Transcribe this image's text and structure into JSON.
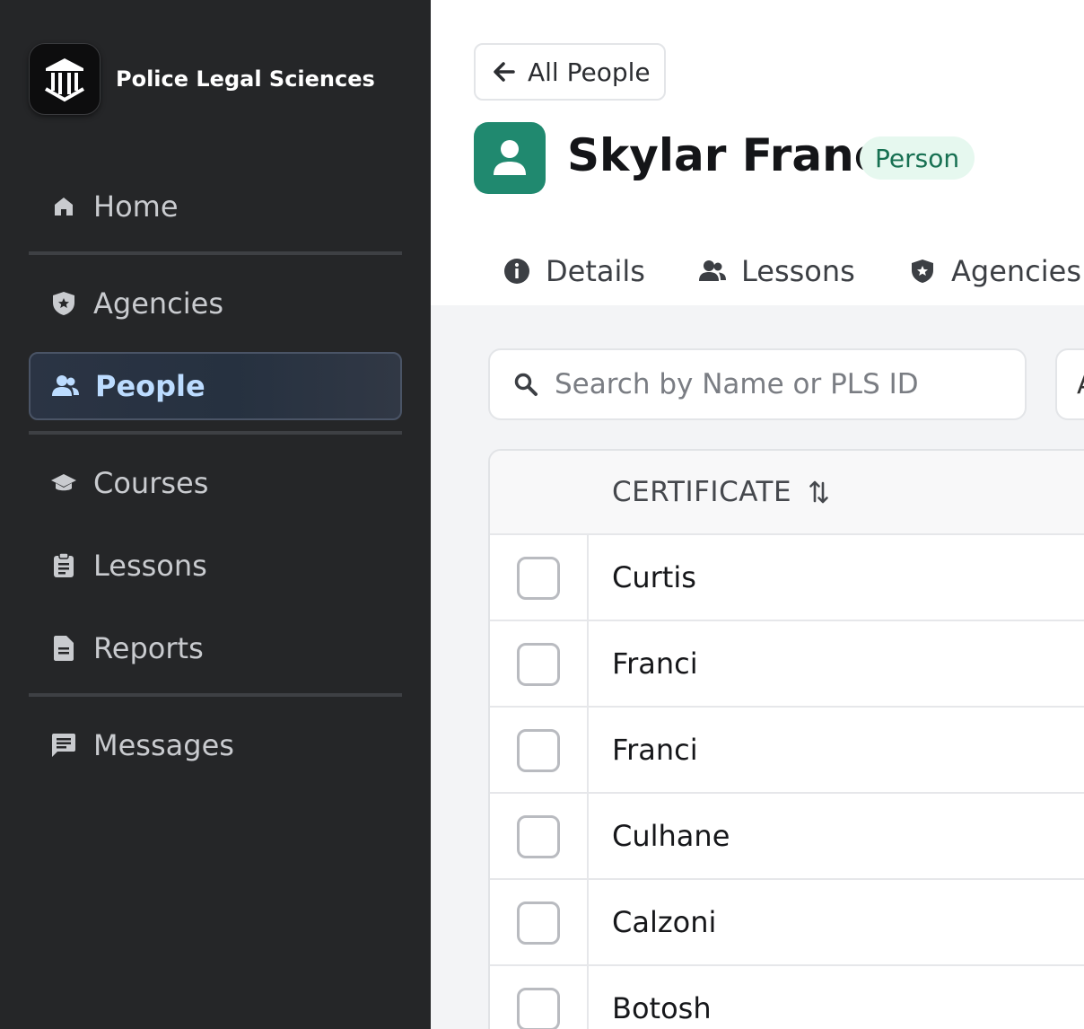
{
  "app": {
    "name": "Police Legal Sciences"
  },
  "sidebar": {
    "items": [
      {
        "label": "Home",
        "icon": "home-icon"
      },
      {
        "label": "Agencies",
        "icon": "shield-star-icon"
      },
      {
        "label": "People",
        "icon": "people-icon",
        "active": true
      },
      {
        "label": "Courses",
        "icon": "graduation-cap-icon"
      },
      {
        "label": "Lessons",
        "icon": "clipboard-icon"
      },
      {
        "label": "Reports",
        "icon": "document-icon"
      },
      {
        "label": "Messages",
        "icon": "message-icon"
      }
    ]
  },
  "header": {
    "back_label": "All People",
    "person_name": "Skylar Franci",
    "person_type": "Person"
  },
  "tabs": [
    {
      "label": "Details",
      "icon": "info-icon"
    },
    {
      "label": "Lessons",
      "icon": "people-icon"
    },
    {
      "label": "Agencies",
      "icon": "shield-star-icon"
    }
  ],
  "search": {
    "placeholder": "Search by Name or PLS ID",
    "value": ""
  },
  "filter": {
    "label": "A"
  },
  "table": {
    "columns": [
      "CERTIFICATE"
    ],
    "rows": [
      {
        "certificate": "Curtis",
        "checked": false
      },
      {
        "certificate": "Franci",
        "checked": false
      },
      {
        "certificate": "Franci",
        "checked": false
      },
      {
        "certificate": "Culhane",
        "checked": false
      },
      {
        "certificate": "Calzoni",
        "checked": false
      },
      {
        "certificate": "Botosh",
        "checked": false
      }
    ]
  },
  "colors": {
    "sidebar_bg": "#252628",
    "active_text": "#bcdcff",
    "avatar_bg": "#20896f",
    "badge_bg": "#e6f8ef",
    "badge_text": "#177052"
  }
}
